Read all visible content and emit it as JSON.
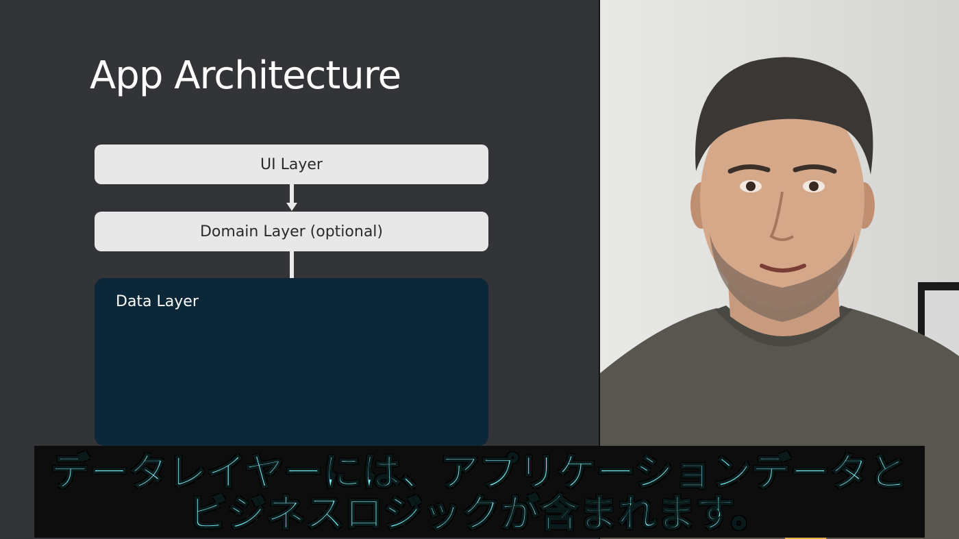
{
  "slide": {
    "title": "App Architecture",
    "layers": {
      "ui": "UI Layer",
      "domain": "Domain Layer (optional)",
      "data": "Data Layer"
    }
  },
  "subtitles": {
    "line1": "データレイヤーには、アプリケーションデータと",
    "line2": "ビジネスロジックが含まれます。"
  },
  "colors": {
    "slide_background": "#323438",
    "light_box": "#e8e8e8",
    "data_box": "#0c2738",
    "subtitle_text": "#7ff7ff",
    "subtitle_background": "#0d0d0d"
  },
  "icons": {
    "connector_arrow": "arrow-down-icon"
  }
}
